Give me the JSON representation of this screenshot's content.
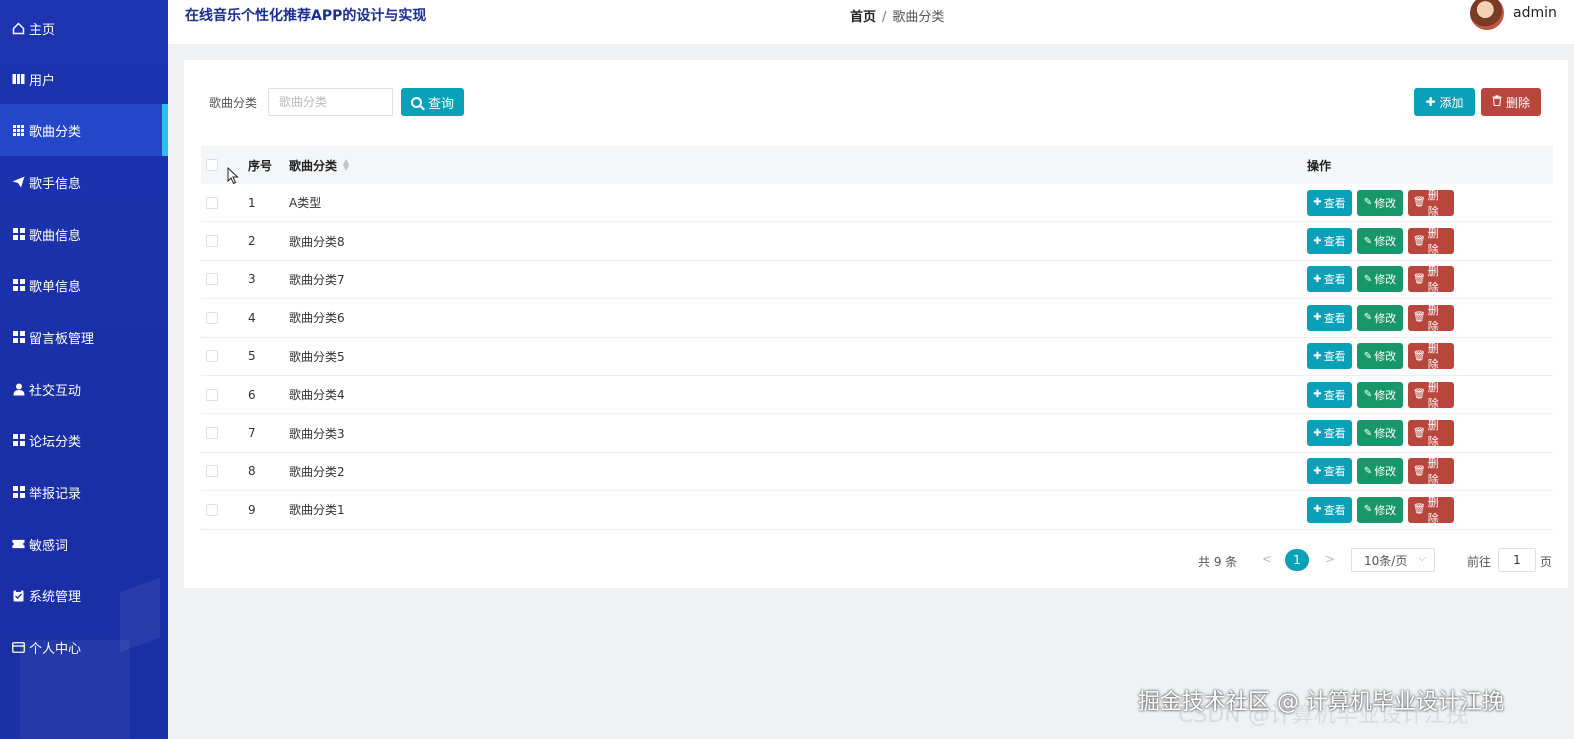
{
  "sidebar": {
    "items": [
      {
        "label": "主页",
        "icon": "home-icon"
      },
      {
        "label": "用户",
        "icon": "book-icon"
      },
      {
        "label": "歌曲分类",
        "icon": "grid-icon",
        "active": true
      },
      {
        "label": "歌手信息",
        "icon": "paper-plane-icon"
      },
      {
        "label": "歌曲信息",
        "icon": "grid-icon"
      },
      {
        "label": "歌单信息",
        "icon": "grid-icon"
      },
      {
        "label": "留言板管理",
        "icon": "grid-icon"
      },
      {
        "label": "社交互动",
        "icon": "user-icon"
      },
      {
        "label": "论坛分类",
        "icon": "grid-icon"
      },
      {
        "label": "举报记录",
        "icon": "grid-icon"
      },
      {
        "label": "敏感词",
        "icon": "ticket-icon"
      },
      {
        "label": "系统管理",
        "icon": "clipboard-icon"
      },
      {
        "label": "个人中心",
        "icon": "card-icon"
      }
    ]
  },
  "header": {
    "title": "在线音乐个性化推荐APP的设计与实现",
    "breadcrumb_home": "首页",
    "breadcrumb_sep": "/",
    "breadcrumb_current": "歌曲分类",
    "username": "admin"
  },
  "search": {
    "label": "歌曲分类",
    "placeholder": "歌曲分类",
    "value": "",
    "query_label": "查询"
  },
  "toolbar": {
    "add_label": "添加",
    "delete_label": "删除"
  },
  "table": {
    "headers": {
      "index": "序号",
      "name": "歌曲分类",
      "ops": "操作"
    },
    "rows": [
      {
        "index": "1",
        "name": "A类型"
      },
      {
        "index": "2",
        "name": "歌曲分类8"
      },
      {
        "index": "3",
        "name": "歌曲分类7"
      },
      {
        "index": "4",
        "name": "歌曲分类6"
      },
      {
        "index": "5",
        "name": "歌曲分类5"
      },
      {
        "index": "6",
        "name": "歌曲分类4"
      },
      {
        "index": "7",
        "name": "歌曲分类3"
      },
      {
        "index": "8",
        "name": "歌曲分类2"
      },
      {
        "index": "9",
        "name": "歌曲分类1"
      }
    ],
    "ops": {
      "view": "查看",
      "edit": "修改",
      "delete": "删除"
    }
  },
  "pagination": {
    "total": "共 9 条",
    "current_page": "1",
    "page_size": "10条/页",
    "goto_label": "前往",
    "goto_value": "1",
    "page_suffix": "页"
  },
  "watermark": {
    "text": "掘金技术社区 @ 计算机毕业设计江挽",
    "shadow_text": "CSDN @计算机毕业设计江挽"
  },
  "colors": {
    "sidebar": "#1d34b0",
    "accent": "#0aa0b8",
    "edit": "#18986a",
    "danger": "#b8463c"
  }
}
